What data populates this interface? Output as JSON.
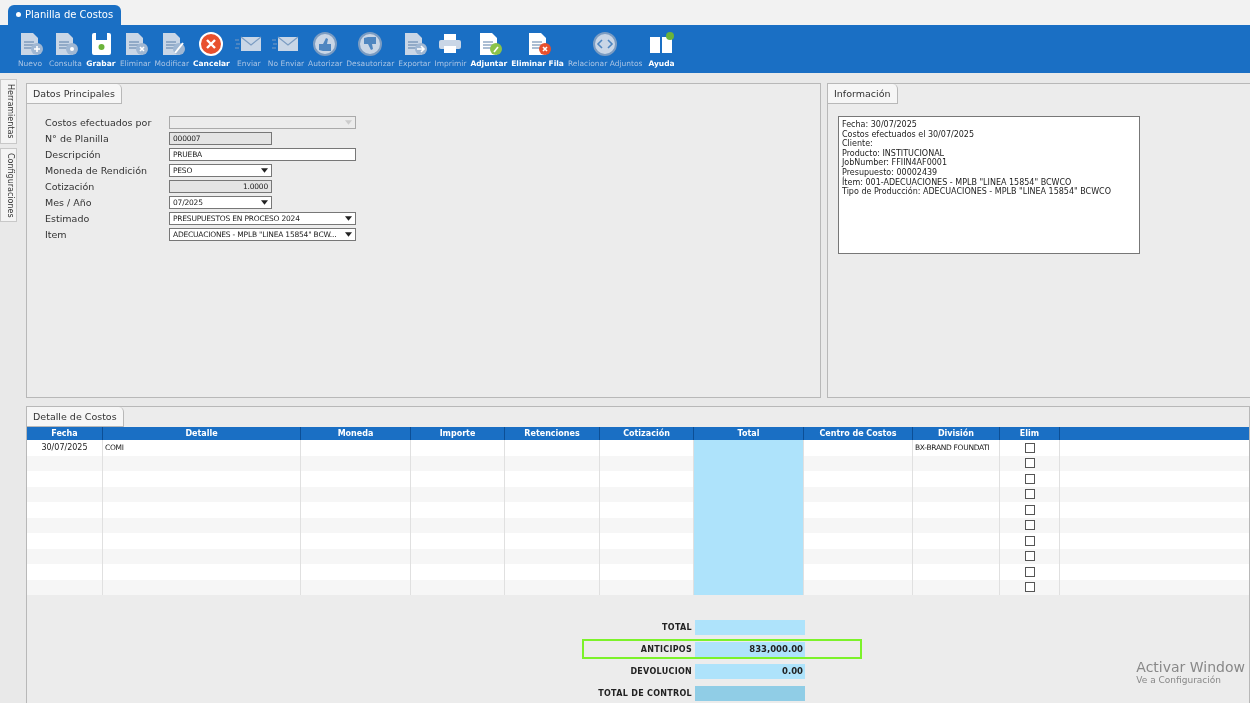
{
  "window": {
    "title": "Planilla de Costos"
  },
  "toolbar": [
    {
      "label": "Nuevo",
      "disabled": true
    },
    {
      "label": "Consulta",
      "disabled": true
    },
    {
      "label": "Grabar",
      "disabled": false
    },
    {
      "label": "Eliminar",
      "disabled": true
    },
    {
      "label": "Modificar",
      "disabled": true
    },
    {
      "label": "Cancelar",
      "disabled": false
    },
    {
      "label": "Enviar",
      "disabled": true
    },
    {
      "label": "No Enviar",
      "disabled": true
    },
    {
      "label": "Autorizar",
      "disabled": true
    },
    {
      "label": "Desautorizar",
      "disabled": true
    },
    {
      "label": "Exportar",
      "disabled": true
    },
    {
      "label": "Imprimir",
      "disabled": true
    },
    {
      "label": "Adjuntar",
      "disabled": false
    },
    {
      "label": "Eliminar Fila",
      "disabled": false
    },
    {
      "label": "Relacionar Adjuntos",
      "disabled": true
    },
    {
      "label": "Ayuda",
      "disabled": false
    }
  ],
  "side_tabs": [
    "Herramientas",
    "Configuraciones"
  ],
  "main_panel": {
    "tab": "Datos Principales",
    "fields": [
      {
        "label": "Costos efectuados por",
        "kind": "select",
        "disabled": true
      },
      {
        "label": "N° de Planilla",
        "kind": "readonly",
        "value": "000007"
      },
      {
        "label": "Descripción",
        "kind": "text",
        "value": "PRUEBA"
      },
      {
        "label": "Moneda de Rendición",
        "kind": "select",
        "value": "PESO",
        "disabled": false
      },
      {
        "label": "Cotización",
        "kind": "readonly",
        "value": "1.0000"
      },
      {
        "label": "Mes / Año",
        "kind": "select",
        "value": "07/2025",
        "disabled": false
      },
      {
        "label": "Estimado",
        "kind": "select",
        "value": "PRESUPUESTOS EN PROCESO 2024",
        "disabled": false
      },
      {
        "label": "Item",
        "kind": "select",
        "value": "ADECUACIONES   - MPLB \"LINEA 15854\" BCW...",
        "disabled": false
      }
    ]
  },
  "info_panel": {
    "tab": "Información",
    "lines": [
      "Fecha: 30/07/2025",
      "Costos efectuados el 30/07/2025",
      "Cliente:",
      "Producto: INSTITUCIONAL",
      "JobNumber: FFIIN4AF0001",
      "Presupuesto: 00002439",
      "Ítem: 001-ADECUACIONES   - MPLB \"LINEA 15854\" BCWCO",
      "Tipo de Producción: ADECUACIONES   - MPLB \"LINEA 15854\" BCWCO"
    ]
  },
  "detail": {
    "tab": "Detalle de Costos",
    "columns": [
      "Fecha",
      "Detalle",
      "Moneda",
      "Importe",
      "Retenciones",
      "Cotización",
      "Total",
      "Centro de Costos",
      "División",
      "Elim"
    ],
    "rows": [
      {
        "cells": [
          "30/07/2025",
          "COMI",
          "",
          "",
          "",
          "",
          "",
          "",
          "BX-BRAND FOUNDATI"
        ],
        "checked": false
      },
      {
        "cells": [],
        "checked": false
      },
      {
        "cells": [],
        "checked": false
      },
      {
        "cells": [],
        "checked": false
      },
      {
        "cells": [],
        "checked": false
      },
      {
        "cells": [],
        "checked": false
      },
      {
        "cells": [],
        "checked": false
      },
      {
        "cells": [],
        "checked": false
      },
      {
        "cells": [],
        "checked": false
      },
      {
        "cells": [],
        "checked": false
      }
    ]
  },
  "totals": [
    {
      "label": "TOTAL",
      "kind": "light"
    },
    {
      "label": "ANTICIPOS",
      "value": "833,000.00",
      "kind": "light",
      "highlighted": true
    },
    {
      "label": "DEVOLUCION",
      "value": "0.00",
      "kind": "light",
      "highlighted": false
    },
    {
      "label": "TOTAL DE CONTROL",
      "kind": "dark"
    }
  ],
  "activation_notice": {
    "title": "Activar Window",
    "subtitle": "Ve a Configuración"
  }
}
